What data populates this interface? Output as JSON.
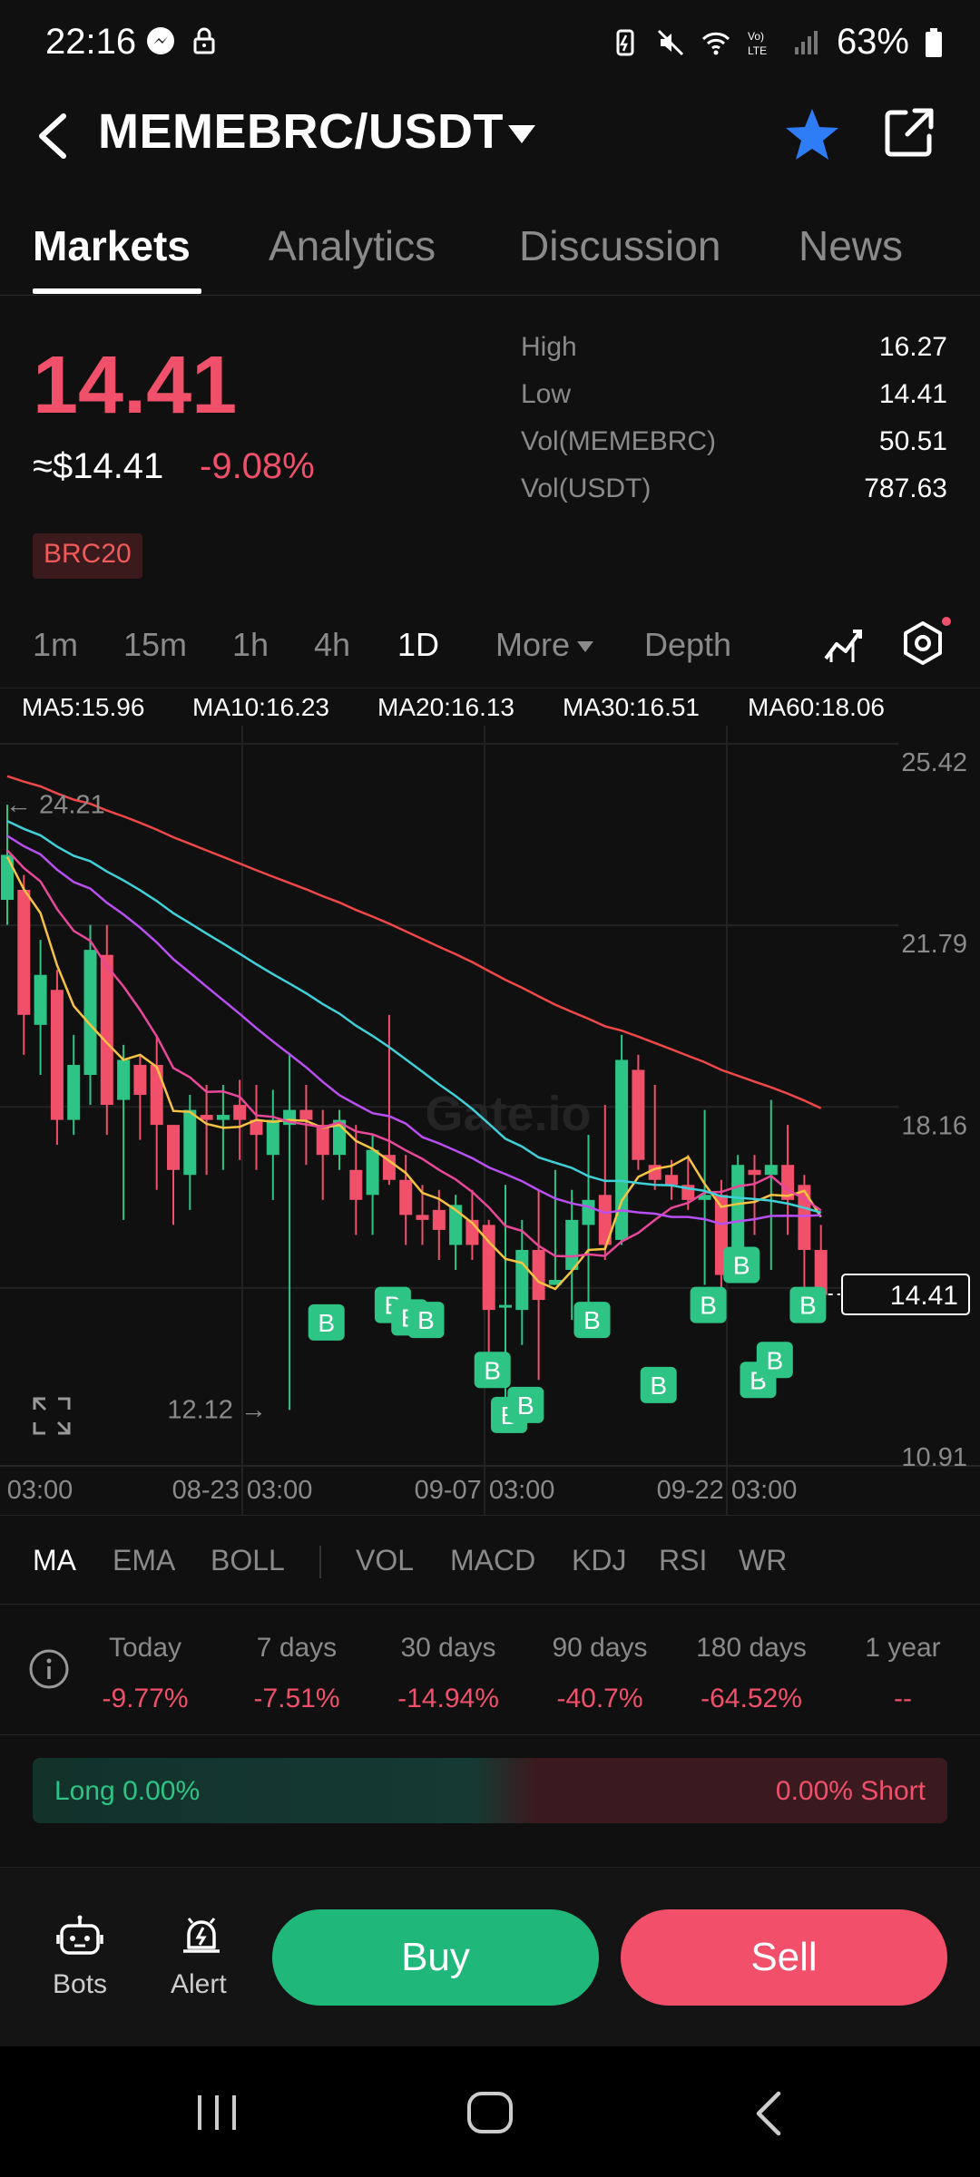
{
  "status_bar": {
    "time": "22:16",
    "battery": "63%"
  },
  "header": {
    "pair": "MEMEBRC/USDT"
  },
  "tabs": [
    {
      "label": "Markets"
    },
    {
      "label": "Analytics"
    },
    {
      "label": "Discussion"
    },
    {
      "label": "News"
    }
  ],
  "price": {
    "last": "14.41",
    "usd": "≈$14.41",
    "change": "-9.08%",
    "tag": "BRC20"
  },
  "stats": [
    {
      "label": "High",
      "value": "16.27"
    },
    {
      "label": "Low",
      "value": "14.41"
    },
    {
      "label": "Vol(MEMEBRC)",
      "value": "50.51"
    },
    {
      "label": "Vol(USDT)",
      "value": "787.63"
    }
  ],
  "intervals": [
    "1m",
    "15m",
    "1h",
    "4h",
    "1D",
    "More",
    "Depth"
  ],
  "ma_legend": [
    {
      "label": "MA5:15.96",
      "color": "#f5c242"
    },
    {
      "label": "MA10:16.23",
      "color": "#e8479a"
    },
    {
      "label": "MA20:16.13",
      "color": "#b84ff0"
    },
    {
      "label": "MA30:16.51",
      "color": "#3fd0d8"
    },
    {
      "label": "MA60:18.06",
      "color": "#f04848"
    }
  ],
  "chart_data": {
    "type": "candlestick",
    "y_ticks": [
      "25.42",
      "21.79",
      "18.16",
      "10.91"
    ],
    "x_ticks": [
      "03:00",
      "08-23 03:00",
      "09-07 03:00",
      "09-22 03:00"
    ],
    "ylim": [
      10.91,
      25.42
    ],
    "high_marker": "← 24.21",
    "low_marker": "12.12 →",
    "last_price": "14.41",
    "watermark": "Gate.io",
    "trade_marker": "B",
    "colors": {
      "up": "#2ec486",
      "down": "#f0506a"
    },
    "candles": [
      {
        "o": 22.3,
        "c": 23.2,
        "h": 24.2,
        "l": 21.8
      },
      {
        "o": 22.5,
        "c": 20.0,
        "h": 22.8,
        "l": 19.2
      },
      {
        "o": 19.8,
        "c": 20.8,
        "h": 21.5,
        "l": 18.8
      },
      {
        "o": 20.5,
        "c": 17.9,
        "h": 20.9,
        "l": 17.4
      },
      {
        "o": 17.9,
        "c": 19.0,
        "h": 19.6,
        "l": 17.6
      },
      {
        "o": 18.8,
        "c": 21.3,
        "h": 21.8,
        "l": 18.2
      },
      {
        "o": 21.2,
        "c": 18.2,
        "h": 21.8,
        "l": 17.6
      },
      {
        "o": 18.3,
        "c": 19.1,
        "h": 19.4,
        "l": 15.9
      },
      {
        "o": 19.0,
        "c": 18.4,
        "h": 19.2,
        "l": 17.5
      },
      {
        "o": 19.0,
        "c": 17.8,
        "h": 19.6,
        "l": 16.5
      },
      {
        "o": 17.8,
        "c": 16.9,
        "h": 17.6,
        "l": 15.8
      },
      {
        "o": 16.8,
        "c": 18.1,
        "h": 18.4,
        "l": 16.1
      },
      {
        "o": 18.0,
        "c": 17.9,
        "h": 18.6,
        "l": 16.8
      },
      {
        "o": 17.9,
        "c": 18.0,
        "h": 18.6,
        "l": 16.9
      },
      {
        "o": 18.2,
        "c": 17.9,
        "h": 18.7,
        "l": 17.1
      },
      {
        "o": 17.9,
        "c": 17.6,
        "h": 18.6,
        "l": 16.9
      },
      {
        "o": 17.2,
        "c": 17.9,
        "h": 18.5,
        "l": 16.3
      },
      {
        "o": 17.8,
        "c": 18.1,
        "h": 19.2,
        "l": 12.1
      },
      {
        "o": 18.1,
        "c": 17.9,
        "h": 18.6,
        "l": 17.0
      },
      {
        "o": 17.8,
        "c": 17.2,
        "h": 18.1,
        "l": 16.3
      },
      {
        "o": 17.2,
        "c": 17.9,
        "h": 18.1,
        "l": 16.9
      },
      {
        "o": 16.9,
        "c": 16.3,
        "h": 17.8,
        "l": 15.6
      },
      {
        "o": 16.4,
        "c": 17.3,
        "h": 17.6,
        "l": 15.6
      },
      {
        "o": 17.2,
        "c": 16.7,
        "h": 20.0,
        "l": 16.6
      },
      {
        "o": 16.7,
        "c": 16.0,
        "h": 17.2,
        "l": 15.4
      },
      {
        "o": 16.0,
        "c": 15.9,
        "h": 16.6,
        "l": 15.4
      },
      {
        "o": 16.1,
        "c": 15.7,
        "h": 16.5,
        "l": 15.1
      },
      {
        "o": 15.4,
        "c": 16.2,
        "h": 16.4,
        "l": 14.9
      },
      {
        "o": 15.9,
        "c": 15.4,
        "h": 16.5,
        "l": 15.1
      },
      {
        "o": 15.8,
        "c": 14.1,
        "h": 15.9,
        "l": 12.8
      },
      {
        "o": 14.2,
        "c": 14.2,
        "h": 16.6,
        "l": 12.3
      },
      {
        "o": 14.1,
        "c": 15.3,
        "h": 15.9,
        "l": 13.4
      },
      {
        "o": 15.3,
        "c": 14.3,
        "h": 16.5,
        "l": 12.7
      },
      {
        "o": 14.6,
        "c": 14.7,
        "h": 16.9,
        "l": 14.6
      },
      {
        "o": 14.9,
        "c": 15.9,
        "h": 16.5,
        "l": 13.9
      },
      {
        "o": 15.8,
        "c": 16.3,
        "h": 17.6,
        "l": 14.0
      },
      {
        "o": 16.4,
        "c": 15.4,
        "h": 18.2,
        "l": 15.1
      },
      {
        "o": 15.5,
        "c": 19.1,
        "h": 19.6,
        "l": 15.4
      },
      {
        "o": 18.9,
        "c": 17.1,
        "h": 19.2,
        "l": 16.9
      },
      {
        "o": 17.0,
        "c": 16.7,
        "h": 18.6,
        "l": 16.5
      },
      {
        "o": 16.8,
        "c": 16.6,
        "h": 17.1,
        "l": 16.3
      },
      {
        "o": 16.6,
        "c": 16.3,
        "h": 17.2,
        "l": 16.1
      },
      {
        "o": 16.3,
        "c": 16.4,
        "h": 18.1,
        "l": 14.6
      },
      {
        "o": 16.4,
        "c": 14.8,
        "h": 16.7,
        "l": 13.9
      },
      {
        "o": 14.8,
        "c": 17.0,
        "h": 17.2,
        "l": 14.7
      },
      {
        "o": 16.9,
        "c": 16.8,
        "h": 17.2,
        "l": 15.6
      },
      {
        "o": 16.8,
        "c": 17.0,
        "h": 18.3,
        "l": 14.9
      },
      {
        "o": 17.0,
        "c": 16.3,
        "h": 17.8,
        "l": 15.6
      },
      {
        "o": 16.6,
        "c": 15.3,
        "h": 16.8,
        "l": 14.0
      },
      {
        "o": 15.3,
        "c": 14.4,
        "h": 15.8,
        "l": 14.2
      }
    ]
  },
  "indicators": [
    "MA",
    "EMA",
    "BOLL",
    "VOL",
    "MACD",
    "KDJ",
    "RSI",
    "WR"
  ],
  "performance": [
    {
      "label": "Today",
      "value": "-9.77%"
    },
    {
      "label": "7 days",
      "value": "-7.51%"
    },
    {
      "label": "30 days",
      "value": "-14.94%"
    },
    {
      "label": "90 days",
      "value": "-40.7%"
    },
    {
      "label": "180 days",
      "value": "-64.52%"
    },
    {
      "label": "1 year",
      "value": "--"
    }
  ],
  "long_short": {
    "long": "Long 0.00%",
    "short": "0.00% Short"
  },
  "bottom": {
    "bots": "Bots",
    "alert": "Alert",
    "buy": "Buy",
    "sell": "Sell"
  }
}
